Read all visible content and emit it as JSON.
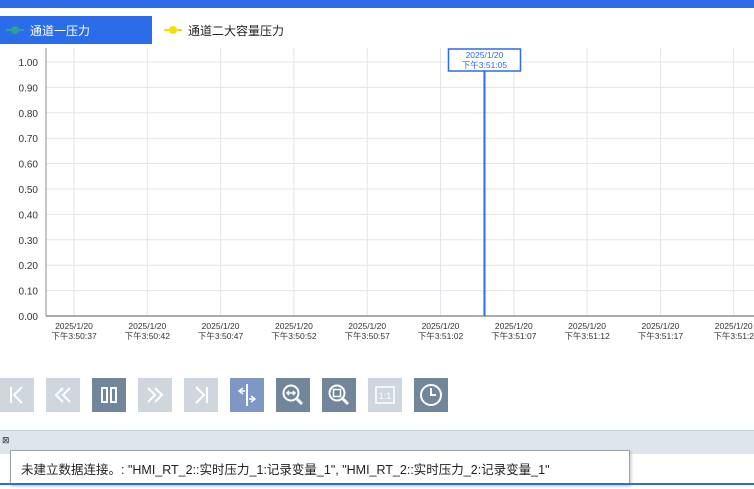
{
  "colors": {
    "accent": "#2b6ce8",
    "series1": "#2aa39a",
    "series2": "#f2e100",
    "cursor": "#2b6ce8",
    "grid": "#e1e5ea"
  },
  "legend": {
    "items": [
      {
        "label": "通道一压力",
        "marker_icon": "line-dot-teal",
        "active": true
      },
      {
        "label": "通道二大容量压力",
        "marker_icon": "line-dot-yellow",
        "active": false
      }
    ]
  },
  "chart_data": {
    "type": "line",
    "ylabels": [
      "1.00",
      "0.90",
      "0.80",
      "0.70",
      "0.60",
      "0.50",
      "0.40",
      "0.30",
      "0.20",
      "0.10",
      "0.00"
    ],
    "ylim": [
      0,
      1.0
    ],
    "x_ticks": [
      {
        "date": "2025/1/20",
        "time": "下午3:50:37"
      },
      {
        "date": "2025/1/20",
        "time": "下午3:50:42"
      },
      {
        "date": "2025/1/20",
        "time": "下午3:50:47"
      },
      {
        "date": "2025/1/20",
        "time": "下午3:50:52"
      },
      {
        "date": "2025/1/20",
        "time": "下午3:50:57"
      },
      {
        "date": "2025/1/20",
        "time": "下午3:51:02"
      },
      {
        "date": "2025/1/20",
        "time": "下午3:51:07"
      },
      {
        "date": "2025/1/20",
        "time": "下午3:51:12"
      },
      {
        "date": "2025/1/20",
        "time": "下午3:51:17"
      },
      {
        "date": "2025/1/20",
        "time": "下午3:51:2"
      }
    ],
    "cursor": {
      "date": "2025/1/20",
      "time": "下午3:51:05"
    },
    "series": [],
    "grid": true
  },
  "toolbar": {
    "buttons": [
      {
        "icon": "first-page-icon",
        "state": "disabled"
      },
      {
        "icon": "rewind-icon",
        "state": "disabled"
      },
      {
        "icon": "pause-icon",
        "state": "enabled"
      },
      {
        "icon": "fast-forward-icon",
        "state": "disabled"
      },
      {
        "icon": "last-page-icon",
        "state": "disabled"
      },
      {
        "icon": "ruler-icon",
        "state": "active"
      },
      {
        "icon": "zoom-range-icon",
        "state": "enabled"
      },
      {
        "icon": "zoom-area-icon",
        "state": "enabled"
      },
      {
        "icon": "original-size-icon",
        "state": "disabled"
      },
      {
        "icon": "clock-icon",
        "state": "enabled"
      }
    ]
  },
  "status": {
    "message": "未建立数据连接。: \"HMI_RT_2::实时压力_1:记录变量_1\", \"HMI_RT_2::实时压力_2:记录变量_1\""
  }
}
